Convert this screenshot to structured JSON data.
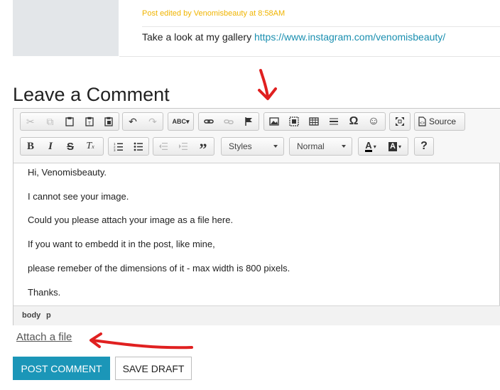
{
  "post": {
    "edited_note": "Post edited by Venomisbeauty at 8:58AM",
    "body_text": "Take a look at my gallery",
    "link_text": "https://www.instagram.com/venomisbeauty/"
  },
  "comment": {
    "heading": "Leave a Comment",
    "toolbar": {
      "source_label": "Source",
      "styles_label": "Styles",
      "format_label": "Normal",
      "help_label": "?"
    },
    "editor_lines": [
      "Hi, Venomisbeauty.",
      "I cannot see your image.",
      "Could you please attach your image as a file here.",
      "If you want to embedd it in the post, like mine,",
      "please remeber of the dimensions of it - max width is 800 pixels.",
      "Thanks."
    ],
    "path": [
      "body",
      "p"
    ],
    "attach_label": "Attach a file",
    "post_button": "POST COMMENT",
    "draft_button": "SAVE DRAFT"
  },
  "colors": {
    "accent": "#1b96b8",
    "edited_note": "#f0b400",
    "link": "#1a8fb0",
    "annotation": "#e02020"
  }
}
